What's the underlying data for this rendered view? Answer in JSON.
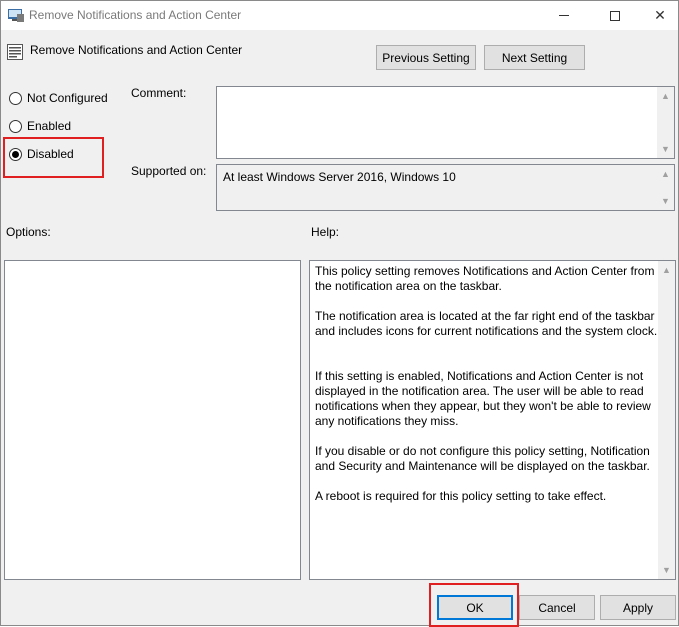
{
  "window": {
    "title": "Remove Notifications and Action Center"
  },
  "policy": {
    "name": "Remove Notifications and Action Center"
  },
  "nav": {
    "previous_label": "Previous Setting",
    "next_label": "Next Setting"
  },
  "state": {
    "options": [
      {
        "label": "Not Configured",
        "checked": false
      },
      {
        "label": "Enabled",
        "checked": false
      },
      {
        "label": "Disabled",
        "checked": true
      }
    ]
  },
  "comment": {
    "label": "Comment:",
    "value": ""
  },
  "supported": {
    "label": "Supported on:",
    "value": "At least Windows Server 2016, Windows 10"
  },
  "options_panel": {
    "label": "Options:"
  },
  "help": {
    "label": "Help:",
    "paragraphs": [
      "This policy setting removes Notifications and Action Center from the notification area on the taskbar.",
      "The notification area is located at the far right end of the taskbar and includes icons for current notifications and the system clock.",
      "If this setting is enabled, Notifications and Action Center is not displayed in the notification area. The user will be able to read notifications when they appear, but they won't be able to review any notifications they miss.",
      "If you disable or do not configure this policy setting, Notification and Security and Maintenance will be displayed on the taskbar.",
      "A reboot is required for this policy setting to take effect."
    ]
  },
  "footer": {
    "ok_label": "OK",
    "cancel_label": "Cancel",
    "apply_label": "Apply"
  },
  "colors": {
    "highlight": "#e02020",
    "focus": "#0078d7"
  }
}
